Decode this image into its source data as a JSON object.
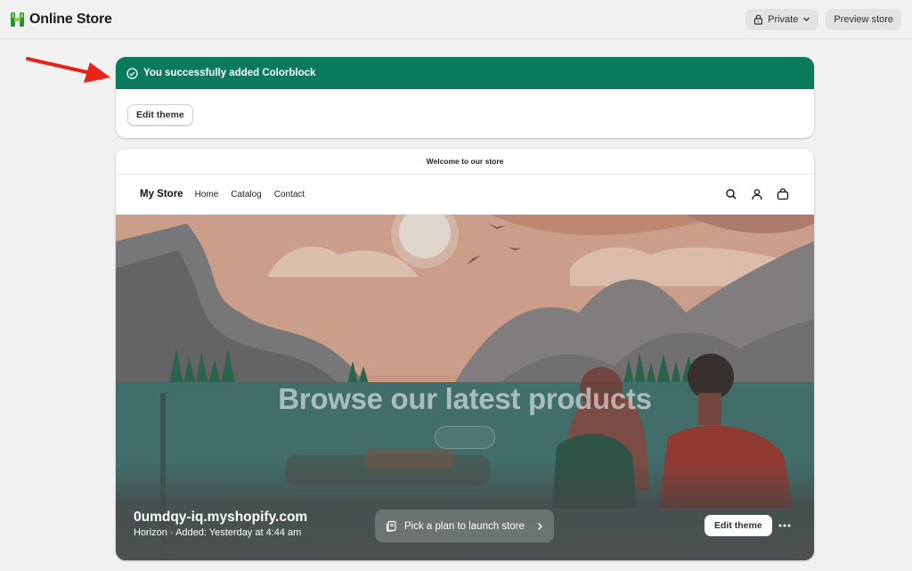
{
  "app": {
    "title": "Online Store"
  },
  "topbar": {
    "visibility_label": "Private",
    "preview_label": "Preview store"
  },
  "banner": {
    "message": "You successfully added Colorblock",
    "edit_theme_label": "Edit theme",
    "color": "#0a7a5d"
  },
  "storefront": {
    "announcement": "Welcome to our store",
    "store_name": "My Store",
    "nav": [
      "Home",
      "Catalog",
      "Contact"
    ],
    "icons": [
      "search-icon",
      "account-icon",
      "cart-icon"
    ],
    "hero_title": "Browse our latest products"
  },
  "theme_card": {
    "domain": "0umdqy-iq.myshopify.com",
    "meta": "Horizon · Added: Yesterday at 4:44 am",
    "plan_label": "Pick a plan to launch store",
    "edit_theme_label": "Edit theme"
  },
  "annotation": {
    "arrow_color": "#e8231c"
  }
}
